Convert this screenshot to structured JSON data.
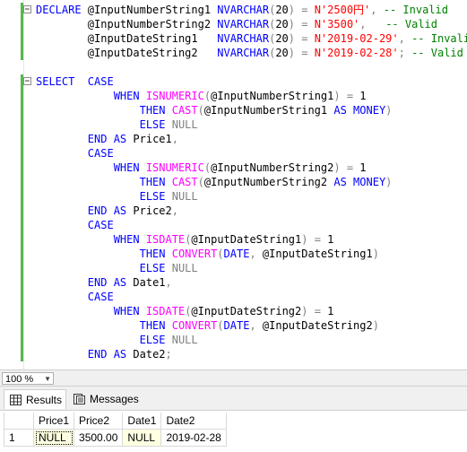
{
  "editor": {
    "lines": [
      [
        {
          "t": "DECLARE ",
          "c": "kw"
        },
        {
          "t": "@InputNumberString1 ",
          "c": ""
        },
        {
          "t": "NVARCHAR",
          "c": "kw"
        },
        {
          "t": "(",
          "c": "gy"
        },
        {
          "t": "20",
          "c": ""
        },
        {
          "t": ")",
          "c": "gy"
        },
        {
          "t": " = ",
          "c": "gy"
        },
        {
          "t": "N'2500円'",
          "c": "str"
        },
        {
          "t": ",",
          "c": "gy"
        },
        {
          "t": " -- Invalid",
          "c": "cm"
        }
      ],
      [
        {
          "t": "        @InputNumberString2 ",
          "c": ""
        },
        {
          "t": "NVARCHAR",
          "c": "kw"
        },
        {
          "t": "(",
          "c": "gy"
        },
        {
          "t": "20",
          "c": ""
        },
        {
          "t": ")",
          "c": "gy"
        },
        {
          "t": " = ",
          "c": "gy"
        },
        {
          "t": "N'3500'",
          "c": "str"
        },
        {
          "t": ",",
          "c": "gy"
        },
        {
          "t": "   -- Valid",
          "c": "cm"
        }
      ],
      [
        {
          "t": "        @InputDateString1   ",
          "c": ""
        },
        {
          "t": "NVARCHAR",
          "c": "kw"
        },
        {
          "t": "(",
          "c": "gy"
        },
        {
          "t": "20",
          "c": ""
        },
        {
          "t": ")",
          "c": "gy"
        },
        {
          "t": " = ",
          "c": "gy"
        },
        {
          "t": "N'2019-02-29'",
          "c": "str"
        },
        {
          "t": ",",
          "c": "gy"
        },
        {
          "t": " -- Invalid",
          "c": "cm"
        }
      ],
      [
        {
          "t": "        @InputDateString2   ",
          "c": ""
        },
        {
          "t": "NVARCHAR",
          "c": "kw"
        },
        {
          "t": "(",
          "c": "gy"
        },
        {
          "t": "20",
          "c": ""
        },
        {
          "t": ")",
          "c": "gy"
        },
        {
          "t": " = ",
          "c": "gy"
        },
        {
          "t": "N'2019-02-28'",
          "c": "str"
        },
        {
          "t": ";",
          "c": "gy"
        },
        {
          "t": " -- Valid",
          "c": "cm"
        }
      ],
      [],
      [
        {
          "t": "SELECT  ",
          "c": "kw"
        },
        {
          "t": "CASE",
          "c": "kw"
        }
      ],
      [
        {
          "t": "            ",
          "c": ""
        },
        {
          "t": "WHEN ",
          "c": "kw"
        },
        {
          "t": "ISNUMERIC",
          "c": "fn"
        },
        {
          "t": "(",
          "c": "gy"
        },
        {
          "t": "@InputNumberString1",
          "c": ""
        },
        {
          "t": ")",
          "c": "gy"
        },
        {
          "t": " = ",
          "c": "gy"
        },
        {
          "t": "1",
          "c": ""
        }
      ],
      [
        {
          "t": "                ",
          "c": ""
        },
        {
          "t": "THEN ",
          "c": "kw"
        },
        {
          "t": "CAST",
          "c": "fn"
        },
        {
          "t": "(",
          "c": "gy"
        },
        {
          "t": "@InputNumberString1 ",
          "c": ""
        },
        {
          "t": "AS ",
          "c": "kw"
        },
        {
          "t": "MONEY",
          "c": "kw"
        },
        {
          "t": ")",
          "c": "gy"
        }
      ],
      [
        {
          "t": "                ",
          "c": ""
        },
        {
          "t": "ELSE ",
          "c": "kw"
        },
        {
          "t": "NULL",
          "c": "gy"
        }
      ],
      [
        {
          "t": "        ",
          "c": ""
        },
        {
          "t": "END ",
          "c": "kw"
        },
        {
          "t": "AS ",
          "c": "kw"
        },
        {
          "t": "Price1",
          "c": ""
        },
        {
          "t": ",",
          "c": "gy"
        }
      ],
      [
        {
          "t": "        ",
          "c": ""
        },
        {
          "t": "CASE",
          "c": "kw"
        }
      ],
      [
        {
          "t": "            ",
          "c": ""
        },
        {
          "t": "WHEN ",
          "c": "kw"
        },
        {
          "t": "ISNUMERIC",
          "c": "fn"
        },
        {
          "t": "(",
          "c": "gy"
        },
        {
          "t": "@InputNumberString2",
          "c": ""
        },
        {
          "t": ")",
          "c": "gy"
        },
        {
          "t": " = ",
          "c": "gy"
        },
        {
          "t": "1",
          "c": ""
        }
      ],
      [
        {
          "t": "                ",
          "c": ""
        },
        {
          "t": "THEN ",
          "c": "kw"
        },
        {
          "t": "CAST",
          "c": "fn"
        },
        {
          "t": "(",
          "c": "gy"
        },
        {
          "t": "@InputNumberString2 ",
          "c": ""
        },
        {
          "t": "AS ",
          "c": "kw"
        },
        {
          "t": "MONEY",
          "c": "kw"
        },
        {
          "t": ")",
          "c": "gy"
        }
      ],
      [
        {
          "t": "                ",
          "c": ""
        },
        {
          "t": "ELSE ",
          "c": "kw"
        },
        {
          "t": "NULL",
          "c": "gy"
        }
      ],
      [
        {
          "t": "        ",
          "c": ""
        },
        {
          "t": "END ",
          "c": "kw"
        },
        {
          "t": "AS ",
          "c": "kw"
        },
        {
          "t": "Price2",
          "c": ""
        },
        {
          "t": ",",
          "c": "gy"
        }
      ],
      [
        {
          "t": "        ",
          "c": ""
        },
        {
          "t": "CASE",
          "c": "kw"
        }
      ],
      [
        {
          "t": "            ",
          "c": ""
        },
        {
          "t": "WHEN ",
          "c": "kw"
        },
        {
          "t": "ISDATE",
          "c": "fn"
        },
        {
          "t": "(",
          "c": "gy"
        },
        {
          "t": "@InputDateString1",
          "c": ""
        },
        {
          "t": ")",
          "c": "gy"
        },
        {
          "t": " = ",
          "c": "gy"
        },
        {
          "t": "1",
          "c": ""
        }
      ],
      [
        {
          "t": "                ",
          "c": ""
        },
        {
          "t": "THEN ",
          "c": "kw"
        },
        {
          "t": "CONVERT",
          "c": "fn"
        },
        {
          "t": "(",
          "c": "gy"
        },
        {
          "t": "DATE",
          "c": "kw"
        },
        {
          "t": ", ",
          "c": "gy"
        },
        {
          "t": "@InputDateString1",
          "c": ""
        },
        {
          "t": ")",
          "c": "gy"
        }
      ],
      [
        {
          "t": "                ",
          "c": ""
        },
        {
          "t": "ELSE ",
          "c": "kw"
        },
        {
          "t": "NULL",
          "c": "gy"
        }
      ],
      [
        {
          "t": "        ",
          "c": ""
        },
        {
          "t": "END ",
          "c": "kw"
        },
        {
          "t": "AS ",
          "c": "kw"
        },
        {
          "t": "Date1",
          "c": ""
        },
        {
          "t": ",",
          "c": "gy"
        }
      ],
      [
        {
          "t": "        ",
          "c": ""
        },
        {
          "t": "CASE",
          "c": "kw"
        }
      ],
      [
        {
          "t": "            ",
          "c": ""
        },
        {
          "t": "WHEN ",
          "c": "kw"
        },
        {
          "t": "ISDATE",
          "c": "fn"
        },
        {
          "t": "(",
          "c": "gy"
        },
        {
          "t": "@InputDateString2",
          "c": ""
        },
        {
          "t": ")",
          "c": "gy"
        },
        {
          "t": " = ",
          "c": "gy"
        },
        {
          "t": "1",
          "c": ""
        }
      ],
      [
        {
          "t": "                ",
          "c": ""
        },
        {
          "t": "THEN ",
          "c": "kw"
        },
        {
          "t": "CONVERT",
          "c": "fn"
        },
        {
          "t": "(",
          "c": "gy"
        },
        {
          "t": "DATE",
          "c": "kw"
        },
        {
          "t": ", ",
          "c": "gy"
        },
        {
          "t": "@InputDateString2",
          "c": ""
        },
        {
          "t": ")",
          "c": "gy"
        }
      ],
      [
        {
          "t": "                ",
          "c": ""
        },
        {
          "t": "ELSE ",
          "c": "kw"
        },
        {
          "t": "NULL",
          "c": "gy"
        }
      ],
      [
        {
          "t": "        ",
          "c": ""
        },
        {
          "t": "END ",
          "c": "kw"
        },
        {
          "t": "AS ",
          "c": "kw"
        },
        {
          "t": "Date2",
          "c": ""
        },
        {
          "t": ";",
          "c": "gy"
        }
      ]
    ]
  },
  "zoom": {
    "value": "100 %"
  },
  "tabs": [
    {
      "label": "Results",
      "icon": "grid-icon",
      "active": true
    },
    {
      "label": "Messages",
      "icon": "messages-icon",
      "active": false
    }
  ],
  "results": {
    "headers": [
      "Price1",
      "Price2",
      "Date1",
      "Date2"
    ],
    "rows": [
      {
        "num": "1",
        "cells": [
          "NULL",
          "3500.00",
          "NULL",
          "2019-02-28"
        ]
      }
    ]
  },
  "colors": {
    "keyword": "#0000ff",
    "function": "#ff00ff",
    "string": "#ff0000",
    "comment": "#008000",
    "operator": "#808080"
  }
}
